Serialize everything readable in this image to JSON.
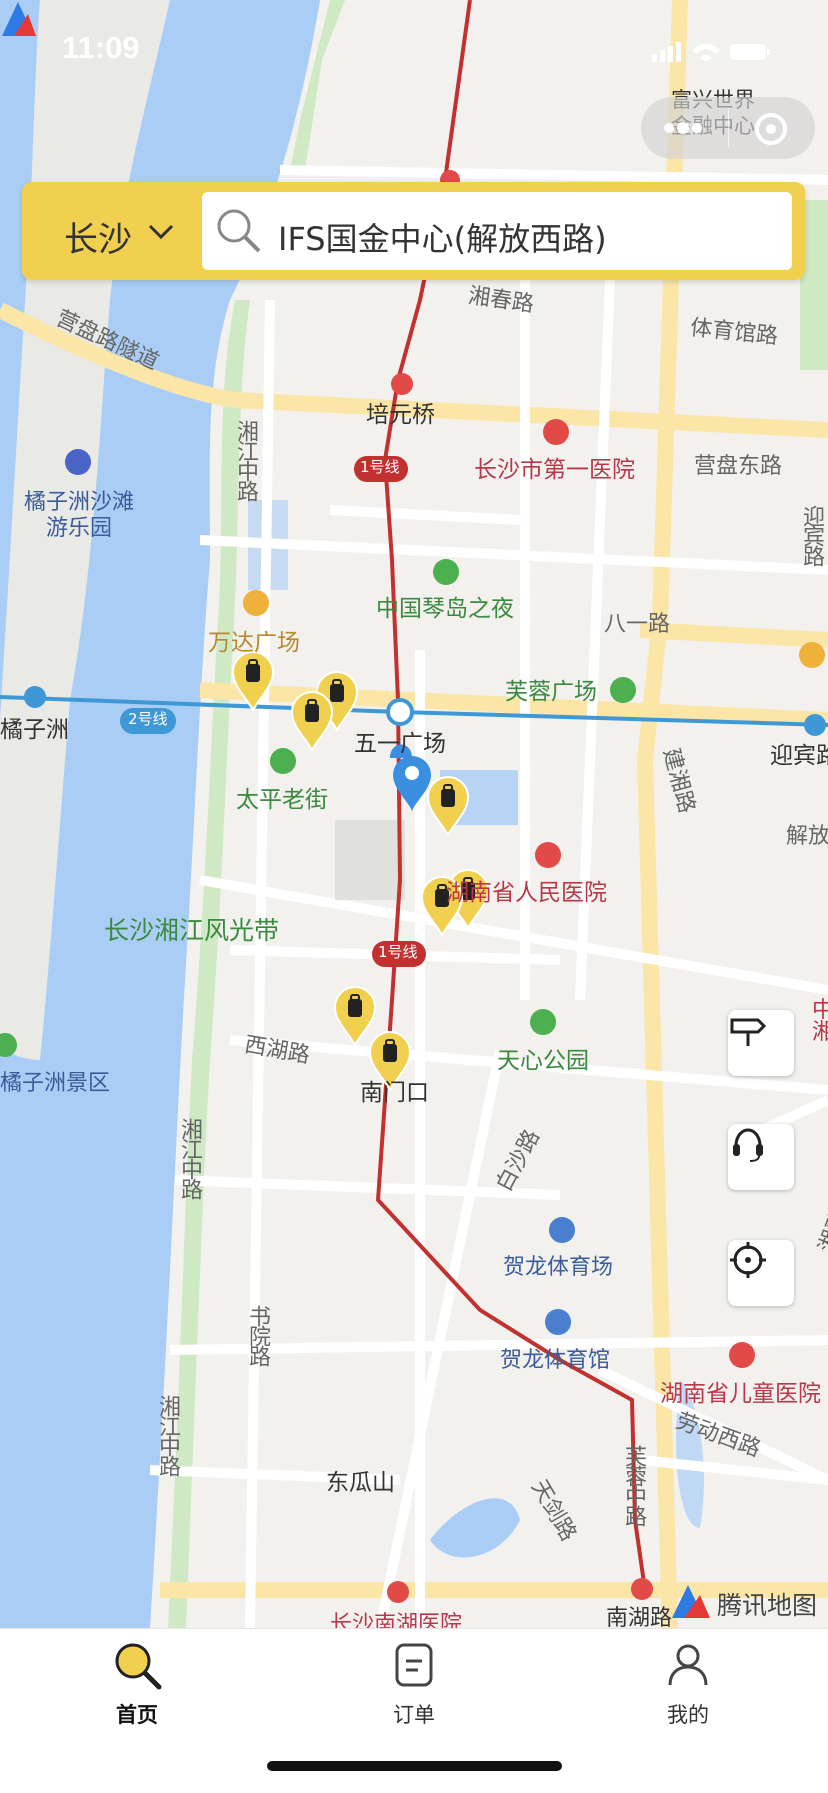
{
  "status_bar": {
    "time": "11:09"
  },
  "search": {
    "city": "长沙",
    "query": "IFS国金中心(解放西路)"
  },
  "map": {
    "provider": "腾讯地图",
    "pin_count": 8,
    "labels": {
      "fuxing": "富兴世界金融中心",
      "xiangchun": "湘春路",
      "tiyuguan": "体育馆路",
      "yingpan_tunnel": "营盘路隧道",
      "peiyuanqiao": "培元桥",
      "line1_a": "1号线",
      "line1_b": "1号线",
      "line2": "2号线",
      "hospital1": "长沙市第一医院",
      "yingpan_east": "营盘东路",
      "juzizhou_beach": "橘子洲沙滩游乐园",
      "xiangjiang_mid_a": "湘江中路",
      "xiangjiang_mid_b": "湘江中路",
      "xiangjiang_mid_c": "湘江中路",
      "yingbin_v": "迎宾路",
      "qindao": "中国琴岛之夜",
      "bayi": "八一路",
      "wanda": "万达广场",
      "furong_sq": "芙蓉广场",
      "juzizhou": "橘子洲",
      "wuyi_sq": "五一广场",
      "yingbin": "迎宾路",
      "taiping": "太平老街",
      "jianxiang": "建湘路",
      "jiefang": "解放西路",
      "renmin_hosp": "湖南省人民医院",
      "fengguang": "长沙湘江风光带",
      "xihu": "西湖路",
      "tianxin": "天心公园",
      "nanmenkou": "南门口",
      "jingqu": "橘子洲景区",
      "baisha": "白沙路",
      "helong1": "贺龙体育场",
      "helong2": "贺龙体育馆",
      "shuyuan": "书院路",
      "child_hosp": "湖南省儿童医院",
      "laodong": "劳动西路",
      "furong_mid": "芙蓉中路",
      "tianjian": "天剑路",
      "dongguashan": "东瓜山",
      "nanhu": "南湖路",
      "yanxi": "湘雅医院",
      "zhongxiang": "中湘",
      "changsha_nanhu_hosp": "长沙南湖医院"
    }
  },
  "nav": {
    "items": [
      {
        "label": "首页",
        "icon": "search-icon",
        "active": true
      },
      {
        "label": "订单",
        "icon": "order-icon",
        "active": false
      },
      {
        "label": "我的",
        "icon": "profile-icon",
        "active": false
      }
    ]
  },
  "colors": {
    "accent": "#f0d04e",
    "metro_line1": "#c0312f",
    "metro_line2": "#3f98d6",
    "river": "#a9cdf5",
    "park_green": "#cfe9c4"
  }
}
